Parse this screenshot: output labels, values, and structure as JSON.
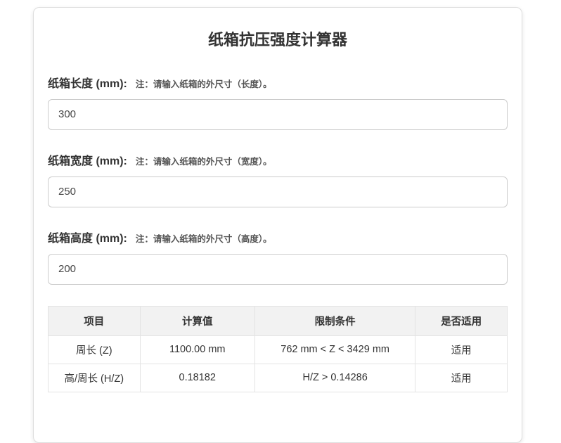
{
  "page": {
    "title": "纸箱抗压强度计算器"
  },
  "colors": {
    "status_ok_green": "#008000",
    "table_header_bg": "#f2f2f2",
    "input_border": "#cccccc",
    "card_border": "#dedede"
  },
  "fields": [
    {
      "label": "纸箱长度 (mm):",
      "note": "注：请输入纸箱的外尺寸（长度）。",
      "value": "300"
    },
    {
      "label": "纸箱宽度 (mm):",
      "note": "注：请输入纸箱的外尺寸（宽度）。",
      "value": "250"
    },
    {
      "label": "纸箱高度 (mm):",
      "note": "注：请输入纸箱的外尺寸（高度）。",
      "value": "200"
    }
  ],
  "table": {
    "headers": [
      "项目",
      "计算值",
      "限制条件",
      "是否适用"
    ],
    "rows": [
      {
        "item": "周长 (Z)",
        "value": "1100.00 mm",
        "condition": "762 mm < Z < 3429 mm",
        "applicable": "适用"
      },
      {
        "item": "高/周长 (H/Z)",
        "value": "0.18182",
        "condition": "H/Z > 0.14286",
        "applicable": "适用"
      }
    ]
  }
}
